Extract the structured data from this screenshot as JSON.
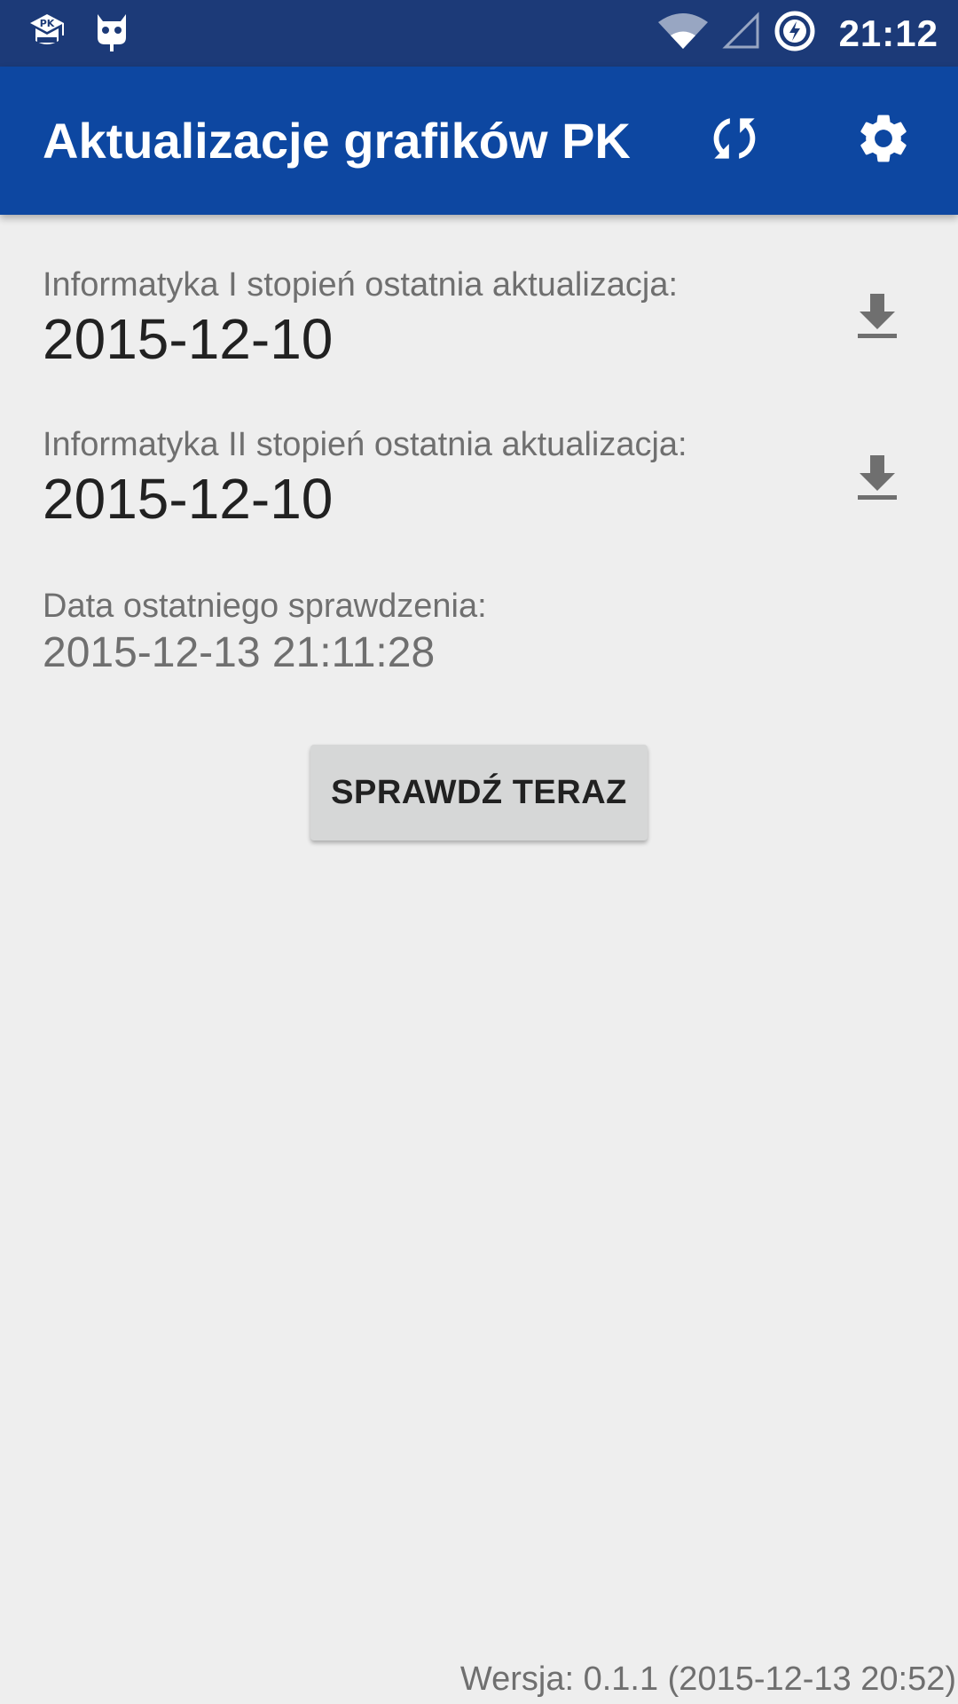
{
  "status_bar": {
    "time": "21:12",
    "notification_icons": [
      "pk-app-icon",
      "cyanogen-icon"
    ],
    "system_icons": [
      "wifi-icon",
      "signal-icon",
      "battery-charging-icon"
    ]
  },
  "app_bar": {
    "title": "Aktualizacje grafików PK",
    "actions": [
      "sync-icon",
      "settings-gear-icon"
    ],
    "color": "#0d47a1"
  },
  "schedules": [
    {
      "label": "Informatyka I stopień ostatnia aktualizacja:",
      "date": "2015-12-10",
      "action_icon": "download-icon"
    },
    {
      "label": "Informatyka II stopień ostatnia aktualizacja:",
      "date": "2015-12-10",
      "action_icon": "download-icon"
    }
  ],
  "last_check": {
    "label": "Data ostatniego sprawdzenia:",
    "value": "2015-12-13 21:11:28"
  },
  "check_button": {
    "label": "SPRAWDŹ TERAZ"
  },
  "footer": {
    "version": "Wersja: 0.1.1 (2015-12-13 20:52)"
  },
  "colors": {
    "status_bar": "#1c3a78",
    "app_bar": "#0d47a1",
    "background": "#eeeeee",
    "button": "#d6d7d7"
  }
}
